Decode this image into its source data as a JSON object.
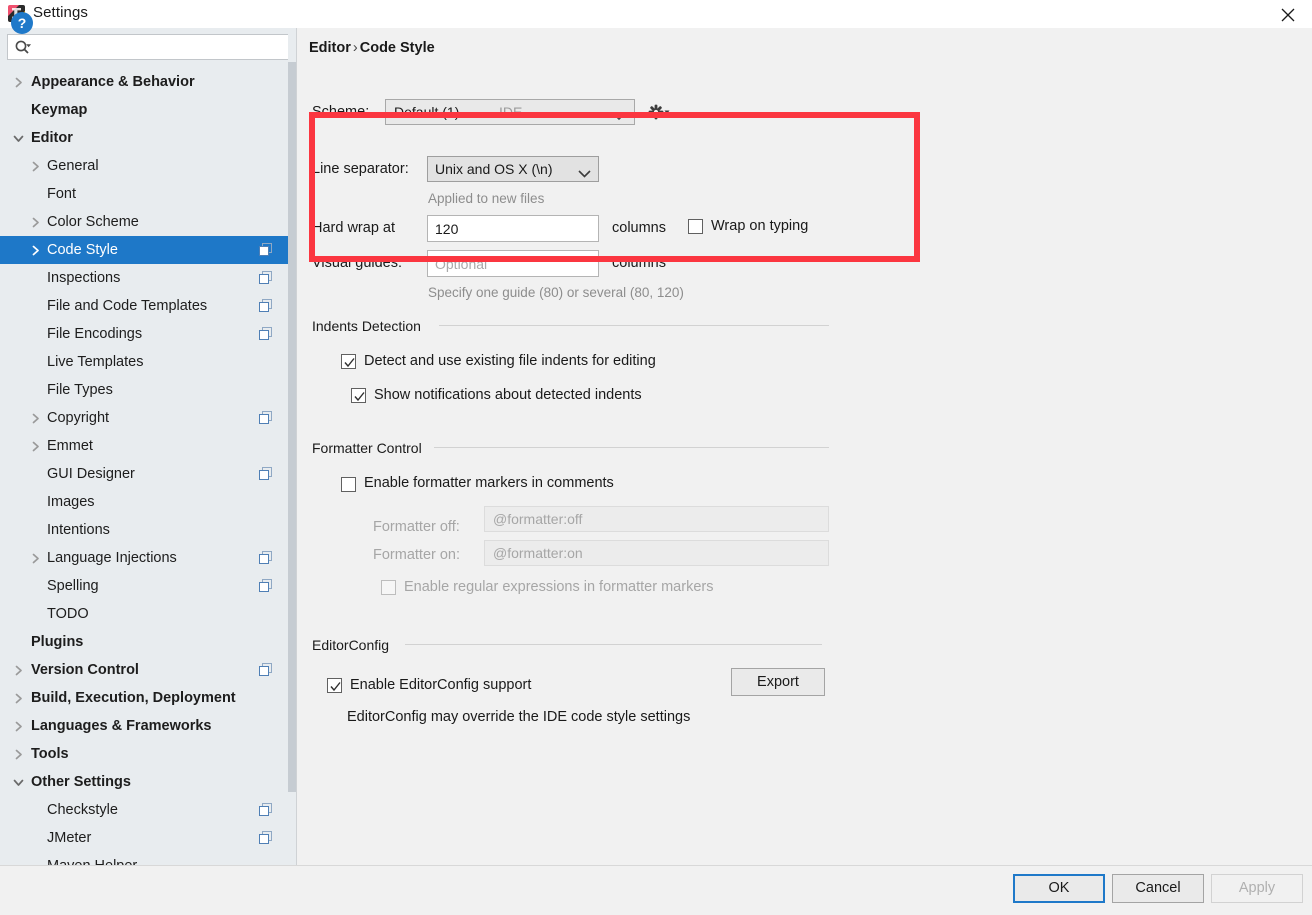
{
  "window": {
    "title": "Settings",
    "app_icon": "intellij-idea-icon",
    "close_icon": "close-icon"
  },
  "sidebar": {
    "search": {
      "placeholder": "",
      "value": "",
      "icon": "search-icon"
    },
    "items": [
      {
        "label": "Appearance & Behavior",
        "indent": 0,
        "bold": true,
        "arrow": "right",
        "badge": false
      },
      {
        "label": "Keymap",
        "indent": 0,
        "bold": true,
        "arrow": "none",
        "badge": false
      },
      {
        "label": "Editor",
        "indent": 0,
        "bold": true,
        "arrow": "down",
        "badge": false
      },
      {
        "label": "General",
        "indent": 1,
        "bold": false,
        "arrow": "right",
        "badge": false
      },
      {
        "label": "Font",
        "indent": 1,
        "bold": false,
        "arrow": "none",
        "badge": false
      },
      {
        "label": "Color Scheme",
        "indent": 1,
        "bold": false,
        "arrow": "right",
        "badge": false
      },
      {
        "label": "Code Style",
        "indent": 1,
        "bold": false,
        "arrow": "right",
        "badge": true,
        "selected": true
      },
      {
        "label": "Inspections",
        "indent": 1,
        "bold": false,
        "arrow": "none",
        "badge": true
      },
      {
        "label": "File and Code Templates",
        "indent": 1,
        "bold": false,
        "arrow": "none",
        "badge": true
      },
      {
        "label": "File Encodings",
        "indent": 1,
        "bold": false,
        "arrow": "none",
        "badge": true
      },
      {
        "label": "Live Templates",
        "indent": 1,
        "bold": false,
        "arrow": "none",
        "badge": false
      },
      {
        "label": "File Types",
        "indent": 1,
        "bold": false,
        "arrow": "none",
        "badge": false
      },
      {
        "label": "Copyright",
        "indent": 1,
        "bold": false,
        "arrow": "right",
        "badge": true
      },
      {
        "label": "Emmet",
        "indent": 1,
        "bold": false,
        "arrow": "right",
        "badge": false
      },
      {
        "label": "GUI Designer",
        "indent": 1,
        "bold": false,
        "arrow": "none",
        "badge": true
      },
      {
        "label": "Images",
        "indent": 1,
        "bold": false,
        "arrow": "none",
        "badge": false
      },
      {
        "label": "Intentions",
        "indent": 1,
        "bold": false,
        "arrow": "none",
        "badge": false
      },
      {
        "label": "Language Injections",
        "indent": 1,
        "bold": false,
        "arrow": "right",
        "badge": true
      },
      {
        "label": "Spelling",
        "indent": 1,
        "bold": false,
        "arrow": "none",
        "badge": true
      },
      {
        "label": "TODO",
        "indent": 1,
        "bold": false,
        "arrow": "none",
        "badge": false
      },
      {
        "label": "Plugins",
        "indent": 0,
        "bold": true,
        "arrow": "none",
        "badge": false
      },
      {
        "label": "Version Control",
        "indent": 0,
        "bold": true,
        "arrow": "right",
        "badge": true
      },
      {
        "label": "Build, Execution, Deployment",
        "indent": 0,
        "bold": true,
        "arrow": "right",
        "badge": false
      },
      {
        "label": "Languages & Frameworks",
        "indent": 0,
        "bold": true,
        "arrow": "right",
        "badge": false
      },
      {
        "label": "Tools",
        "indent": 0,
        "bold": true,
        "arrow": "right",
        "badge": false
      },
      {
        "label": "Other Settings",
        "indent": 0,
        "bold": true,
        "arrow": "down",
        "badge": false
      },
      {
        "label": "Checkstyle",
        "indent": 1,
        "bold": false,
        "arrow": "none",
        "badge": true
      },
      {
        "label": "JMeter",
        "indent": 1,
        "bold": false,
        "arrow": "none",
        "badge": true
      },
      {
        "label": "Maven Helper",
        "indent": 1,
        "bold": false,
        "arrow": "none",
        "badge": false
      }
    ]
  },
  "main": {
    "breadcrumb": {
      "parent": "Editor",
      "separator": "›",
      "current": "Code Style"
    },
    "scheme": {
      "label": "Scheme:",
      "value": "Default (1)",
      "suffix": "IDE",
      "chevron_icon": "chevron-down-icon",
      "gear_icon": "gear-icon"
    },
    "line_separator": {
      "label": "Line separator:",
      "value": "Unix and OS X (\\n)",
      "hint": "Applied to new files",
      "chevron_icon": "chevron-down-icon"
    },
    "hard_wrap": {
      "label": "Hard wrap at",
      "value": "120",
      "unit": "columns"
    },
    "wrap_on_typing": {
      "label": "Wrap on typing",
      "checked": false
    },
    "visual_guides": {
      "label": "Visual guides:",
      "value": "",
      "placeholder": "Optional",
      "unit": "columns",
      "hint": "Specify one guide (80) or several (80, 120)"
    },
    "indents_detection": {
      "title": "Indents Detection",
      "detect_indents": {
        "label": "Detect and use existing file indents for editing",
        "checked": true
      },
      "show_notifications": {
        "label": "Show notifications about detected indents",
        "checked": true
      }
    },
    "formatter_control": {
      "title": "Formatter Control",
      "enable_markers": {
        "label": "Enable formatter markers in comments",
        "checked": false
      },
      "formatter_off": {
        "label": "Formatter off:",
        "placeholder": "@formatter:off",
        "disabled": true
      },
      "formatter_on": {
        "label": "Formatter on:",
        "placeholder": "@formatter:on",
        "disabled": true
      },
      "enable_regex": {
        "label": "Enable regular expressions in formatter markers",
        "checked": false,
        "disabled": true
      }
    },
    "editor_config": {
      "title": "EditorConfig",
      "enable_support": {
        "label": "Enable EditorConfig support",
        "checked": true
      },
      "export_button": "Export",
      "hint": "EditorConfig may override the IDE code style settings"
    }
  },
  "annotation": {
    "color": "#fb3640"
  },
  "footer": {
    "help_icon": "help-icon",
    "help_glyph": "?",
    "ok": "OK",
    "cancel": "Cancel",
    "apply": "Apply"
  }
}
